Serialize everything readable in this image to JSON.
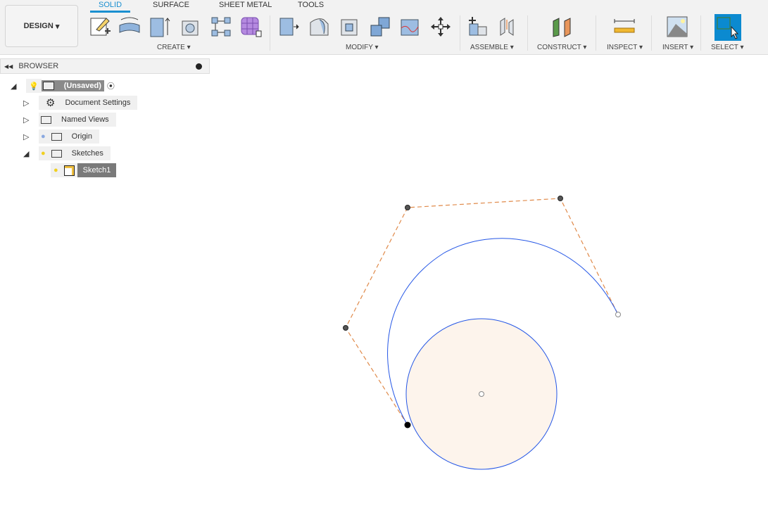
{
  "toolbar": {
    "design_label": "DESIGN",
    "tabs": [
      "SOLID",
      "SURFACE",
      "SHEET METAL",
      "TOOLS"
    ],
    "active_tab": "SOLID",
    "groups": {
      "create": "CREATE",
      "modify": "MODIFY",
      "assemble": "ASSEMBLE",
      "construct": "CONSTRUCT",
      "inspect": "INSPECT",
      "insert": "INSERT",
      "select": "SELECT"
    },
    "accent": "#1a8fd0"
  },
  "browser": {
    "title": "BROWSER",
    "root": "(Unsaved)",
    "items": [
      "Document Settings",
      "Named Views",
      "Origin",
      "Sketches"
    ],
    "sketch": "Sketch1"
  },
  "canvas": {
    "spline_color": "#2456e6",
    "control_polygon_color": "#e08a4a",
    "circle_fill": "#fdf4ec"
  }
}
